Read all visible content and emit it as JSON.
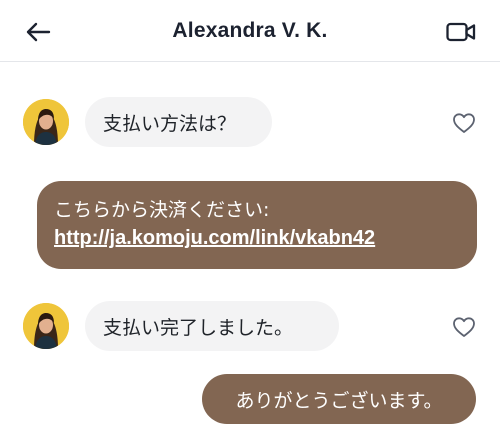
{
  "header": {
    "title": "Alexandra V. K.",
    "back_icon": "arrow-left-icon",
    "video_icon": "video-camera-icon"
  },
  "messages": [
    {
      "direction": "incoming",
      "text": "支払い方法は？",
      "avatar": "user-avatar",
      "liked": false
    },
    {
      "direction": "outgoing",
      "text": "こちらから決済ください:",
      "link": "http://ja.komoju.com/link/vkabn42"
    },
    {
      "direction": "incoming",
      "text": "支払い完了しました。",
      "avatar": "user-avatar",
      "liked": false
    },
    {
      "direction": "outgoing",
      "text": "ありがとうございます。"
    }
  ],
  "colors": {
    "outgoing_bubble": "#826652",
    "incoming_bubble": "#f3f3f4",
    "avatar_background": "#efc53a"
  }
}
